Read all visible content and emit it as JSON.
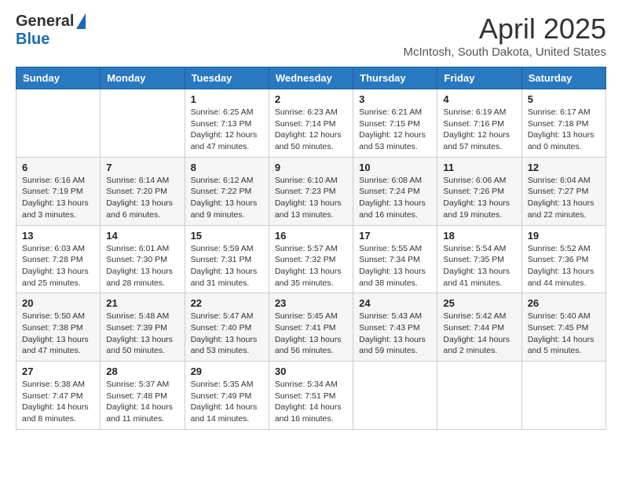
{
  "header": {
    "logo_general": "General",
    "logo_blue": "Blue",
    "month_title": "April 2025",
    "location": "McIntosh, South Dakota, United States"
  },
  "weekdays": [
    "Sunday",
    "Monday",
    "Tuesday",
    "Wednesday",
    "Thursday",
    "Friday",
    "Saturday"
  ],
  "weeks": [
    [
      {
        "day": null,
        "info": null
      },
      {
        "day": null,
        "info": null
      },
      {
        "day": "1",
        "info": "Sunrise: 6:25 AM\nSunset: 7:13 PM\nDaylight: 12 hours\nand 47 minutes."
      },
      {
        "day": "2",
        "info": "Sunrise: 6:23 AM\nSunset: 7:14 PM\nDaylight: 12 hours\nand 50 minutes."
      },
      {
        "day": "3",
        "info": "Sunrise: 6:21 AM\nSunset: 7:15 PM\nDaylight: 12 hours\nand 53 minutes."
      },
      {
        "day": "4",
        "info": "Sunrise: 6:19 AM\nSunset: 7:16 PM\nDaylight: 12 hours\nand 57 minutes."
      },
      {
        "day": "5",
        "info": "Sunrise: 6:17 AM\nSunset: 7:18 PM\nDaylight: 13 hours\nand 0 minutes."
      }
    ],
    [
      {
        "day": "6",
        "info": "Sunrise: 6:16 AM\nSunset: 7:19 PM\nDaylight: 13 hours\nand 3 minutes."
      },
      {
        "day": "7",
        "info": "Sunrise: 6:14 AM\nSunset: 7:20 PM\nDaylight: 13 hours\nand 6 minutes."
      },
      {
        "day": "8",
        "info": "Sunrise: 6:12 AM\nSunset: 7:22 PM\nDaylight: 13 hours\nand 9 minutes."
      },
      {
        "day": "9",
        "info": "Sunrise: 6:10 AM\nSunset: 7:23 PM\nDaylight: 13 hours\nand 13 minutes."
      },
      {
        "day": "10",
        "info": "Sunrise: 6:08 AM\nSunset: 7:24 PM\nDaylight: 13 hours\nand 16 minutes."
      },
      {
        "day": "11",
        "info": "Sunrise: 6:06 AM\nSunset: 7:26 PM\nDaylight: 13 hours\nand 19 minutes."
      },
      {
        "day": "12",
        "info": "Sunrise: 6:04 AM\nSunset: 7:27 PM\nDaylight: 13 hours\nand 22 minutes."
      }
    ],
    [
      {
        "day": "13",
        "info": "Sunrise: 6:03 AM\nSunset: 7:28 PM\nDaylight: 13 hours\nand 25 minutes."
      },
      {
        "day": "14",
        "info": "Sunrise: 6:01 AM\nSunset: 7:30 PM\nDaylight: 13 hours\nand 28 minutes."
      },
      {
        "day": "15",
        "info": "Sunrise: 5:59 AM\nSunset: 7:31 PM\nDaylight: 13 hours\nand 31 minutes."
      },
      {
        "day": "16",
        "info": "Sunrise: 5:57 AM\nSunset: 7:32 PM\nDaylight: 13 hours\nand 35 minutes."
      },
      {
        "day": "17",
        "info": "Sunrise: 5:55 AM\nSunset: 7:34 PM\nDaylight: 13 hours\nand 38 minutes."
      },
      {
        "day": "18",
        "info": "Sunrise: 5:54 AM\nSunset: 7:35 PM\nDaylight: 13 hours\nand 41 minutes."
      },
      {
        "day": "19",
        "info": "Sunrise: 5:52 AM\nSunset: 7:36 PM\nDaylight: 13 hours\nand 44 minutes."
      }
    ],
    [
      {
        "day": "20",
        "info": "Sunrise: 5:50 AM\nSunset: 7:38 PM\nDaylight: 13 hours\nand 47 minutes."
      },
      {
        "day": "21",
        "info": "Sunrise: 5:48 AM\nSunset: 7:39 PM\nDaylight: 13 hours\nand 50 minutes."
      },
      {
        "day": "22",
        "info": "Sunrise: 5:47 AM\nSunset: 7:40 PM\nDaylight: 13 hours\nand 53 minutes."
      },
      {
        "day": "23",
        "info": "Sunrise: 5:45 AM\nSunset: 7:41 PM\nDaylight: 13 hours\nand 56 minutes."
      },
      {
        "day": "24",
        "info": "Sunrise: 5:43 AM\nSunset: 7:43 PM\nDaylight: 13 hours\nand 59 minutes."
      },
      {
        "day": "25",
        "info": "Sunrise: 5:42 AM\nSunset: 7:44 PM\nDaylight: 14 hours\nand 2 minutes."
      },
      {
        "day": "26",
        "info": "Sunrise: 5:40 AM\nSunset: 7:45 PM\nDaylight: 14 hours\nand 5 minutes."
      }
    ],
    [
      {
        "day": "27",
        "info": "Sunrise: 5:38 AM\nSunset: 7:47 PM\nDaylight: 14 hours\nand 8 minutes."
      },
      {
        "day": "28",
        "info": "Sunrise: 5:37 AM\nSunset: 7:48 PM\nDaylight: 14 hours\nand 11 minutes."
      },
      {
        "day": "29",
        "info": "Sunrise: 5:35 AM\nSunset: 7:49 PM\nDaylight: 14 hours\nand 14 minutes."
      },
      {
        "day": "30",
        "info": "Sunrise: 5:34 AM\nSunset: 7:51 PM\nDaylight: 14 hours\nand 16 minutes."
      },
      {
        "day": null,
        "info": null
      },
      {
        "day": null,
        "info": null
      },
      {
        "day": null,
        "info": null
      }
    ]
  ]
}
